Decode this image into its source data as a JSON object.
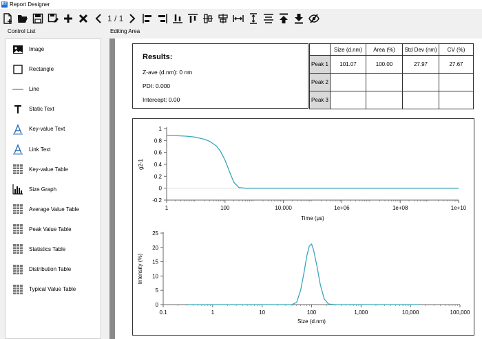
{
  "window": {
    "title": "Report Designer",
    "icon_text": "RT"
  },
  "toolbar": {
    "page_indicator": "1 / 1"
  },
  "sections": {
    "control_list": "Control List",
    "editing_area": "Editing Area"
  },
  "control_list": [
    {
      "label": "Image",
      "icon": "image-icon"
    },
    {
      "label": "Rectangle",
      "icon": "rectangle-icon"
    },
    {
      "label": "Line",
      "icon": "line-icon"
    },
    {
      "label": "Static Text",
      "icon": "static-text-icon"
    },
    {
      "label": "Key-value Text",
      "icon": "key-value-text-icon"
    },
    {
      "label": "Link Text",
      "icon": "link-text-icon"
    },
    {
      "label": "Key-value Table",
      "icon": "table-icon"
    },
    {
      "label": "Size Graph",
      "icon": "size-graph-icon"
    },
    {
      "label": "Average Value Table",
      "icon": "table-icon"
    },
    {
      "label": "Peak Value Table",
      "icon": "table-icon"
    },
    {
      "label": "Statistics Table",
      "icon": "table-icon"
    },
    {
      "label": "Distribution Table",
      "icon": "table-icon"
    },
    {
      "label": "Typical Value Table",
      "icon": "table-icon"
    }
  ],
  "results": {
    "title": "Results:",
    "lines": [
      "Z-ave (d.nm):  0 nm",
      "PDI:  0.000",
      "Intercept:  0.00"
    ]
  },
  "peak_table": {
    "headers": [
      "Size (d.nm)",
      "Area (%)",
      "Std Dev (nm)",
      "CV (%)"
    ],
    "rows": [
      {
        "label": "Peak 1",
        "values": [
          "101.07",
          "100.00",
          "27.97",
          "27.67"
        ]
      },
      {
        "label": "Peak 2",
        "values": [
          "",
          "",
          "",
          ""
        ]
      },
      {
        "label": "Peak 3",
        "values": [
          "",
          "",
          "",
          ""
        ]
      }
    ]
  },
  "chart_data": [
    {
      "type": "line",
      "xscale": "log",
      "xlabel": "Time (μs)",
      "ylabel": "g2-1",
      "xlim": [
        1,
        10000000000
      ],
      "ylim": [
        -0.2,
        1
      ],
      "xticks": [
        1,
        100,
        10000,
        1000000,
        100000000,
        10000000000
      ],
      "xtick_labels": [
        "1",
        "100",
        "10,000",
        "1e+06",
        "1e+08",
        "1e+10"
      ],
      "yticks": [
        1,
        0.8,
        0.6,
        0.4,
        0.2,
        0,
        -0.2
      ],
      "ytick_labels": [
        "1",
        "0.8",
        "0.6",
        "0.4",
        "0.2",
        "0",
        "-0.2"
      ],
      "grid": false,
      "color": "#3aa6b9",
      "series": [
        {
          "x": [
            1,
            2,
            5,
            10,
            20,
            30,
            50,
            70,
            100,
            150,
            200,
            300,
            500,
            1000,
            100000,
            10000000,
            10000000000
          ],
          "y": [
            0.885,
            0.882,
            0.872,
            0.855,
            0.82,
            0.785,
            0.71,
            0.62,
            0.47,
            0.25,
            0.1,
            0.01,
            0.0,
            0.0,
            0.0,
            0.0,
            0.0
          ]
        }
      ]
    },
    {
      "type": "line",
      "xscale": "log",
      "xlabel": "Size (d.nm)",
      "ylabel": "Intensity (%)",
      "xlim": [
        0.1,
        100000
      ],
      "ylim": [
        0,
        25
      ],
      "xticks": [
        0.1,
        1,
        10,
        100,
        1000,
        10000,
        100000
      ],
      "xtick_labels": [
        "0.1",
        "1",
        "10",
        "100",
        "1,000",
        "10,000",
        "100,000"
      ],
      "yticks": [
        25,
        20,
        15,
        10,
        5,
        0
      ],
      "ytick_labels": [
        "25",
        "20",
        "15",
        "10",
        "5",
        "0"
      ],
      "grid": false,
      "color": "#3aa6b9",
      "series": [
        {
          "x": [
            0.3,
            40,
            50,
            60,
            70,
            80,
            90,
            100,
            110,
            130,
            150,
            180,
            220,
            300,
            15000
          ],
          "y": [
            0,
            0,
            0.8,
            5,
            11,
            17,
            20.5,
            21.2,
            19,
            13,
            7,
            2,
            0.2,
            0,
            0
          ]
        }
      ]
    }
  ]
}
